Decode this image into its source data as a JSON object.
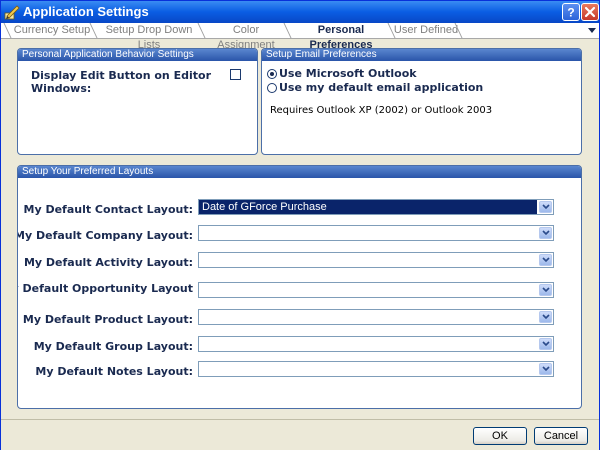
{
  "window": {
    "title": "Application Settings",
    "help_label": "?",
    "close_label": "×"
  },
  "tabs": [
    {
      "label": "Currency Setup",
      "active": false
    },
    {
      "label": "Setup Drop Down Lists",
      "active": false
    },
    {
      "label": "Color Assignment",
      "active": false
    },
    {
      "label": "Personal Preferences",
      "active": true
    },
    {
      "label": "User Defined",
      "active": false
    }
  ],
  "behavior": {
    "header": "Personal Application Behavior Settings",
    "edit_button_label": "Display Edit Button on Editor Windows:",
    "edit_button_checked": false
  },
  "email": {
    "header": "Setup Email Preferences",
    "options": [
      {
        "label": "Use Microsoft Outlook",
        "checked": true
      },
      {
        "label": "Use my default email application",
        "checked": false
      }
    ],
    "note": "Requires Outlook XP (2002) or Outlook 2003"
  },
  "layouts": {
    "header": "Setup Your Preferred Layouts",
    "rows": [
      {
        "label": "My Default Contact Layout:",
        "value": "Date of GForce Purchase",
        "selected": true
      },
      {
        "label": "My Default Company Layout:",
        "value": ""
      },
      {
        "label": "My Default Activity Layout:",
        "value": ""
      },
      {
        "label": "My Default Opportunity Layout",
        "value": ""
      },
      {
        "label": "My Default Product Layout:",
        "value": ""
      },
      {
        "label": "My Default Group Layout:",
        "value": ""
      },
      {
        "label": "My Default Notes Layout:",
        "value": ""
      }
    ]
  },
  "buttons": {
    "ok": "OK",
    "cancel": "Cancel"
  },
  "colors": {
    "title_bar": "#0a5de3",
    "group_header": "#2a55a9",
    "selection": "#0a246a"
  }
}
